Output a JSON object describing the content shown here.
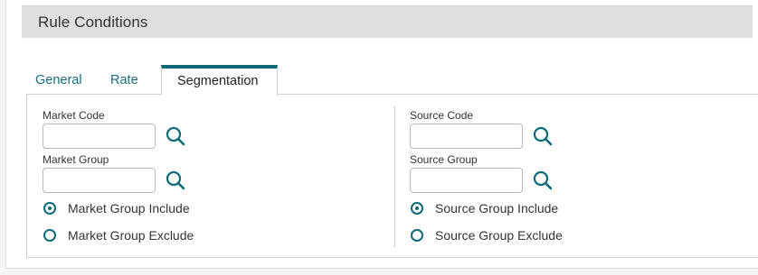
{
  "header": {
    "title": "Rule Conditions"
  },
  "tabs": [
    {
      "label": "General",
      "active": false
    },
    {
      "label": "Rate",
      "active": false
    },
    {
      "label": "Segmentation",
      "active": true
    }
  ],
  "left": {
    "market_code": {
      "label": "Market Code",
      "value": "",
      "search_icon": "search-icon"
    },
    "market_group": {
      "label": "Market Group",
      "value": "",
      "search_icon": "search-icon"
    },
    "radios": [
      {
        "label": "Market Group Include",
        "checked": true
      },
      {
        "label": "Market Group Exclude",
        "checked": false
      }
    ]
  },
  "right": {
    "source_code": {
      "label": "Source Code",
      "value": "",
      "search_icon": "search-icon"
    },
    "source_group": {
      "label": "Source Group",
      "value": "",
      "search_icon": "search-icon"
    },
    "radios": [
      {
        "label": "Source Group Include",
        "checked": true
      },
      {
        "label": "Source Group Exclude",
        "checked": false
      }
    ]
  },
  "colors": {
    "accent": "#0e6a78",
    "tab_text": "#1a6e7d",
    "header_bg": "#dfdfdd"
  }
}
